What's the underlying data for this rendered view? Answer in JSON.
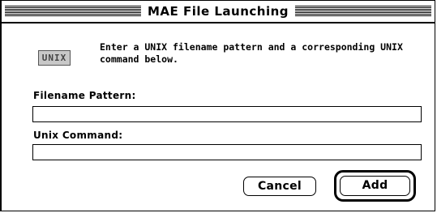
{
  "dialog": {
    "title": "MAE File Launching",
    "icon": {
      "name": "unix-icon",
      "label": "UNIX"
    },
    "message": "Enter a UNIX filename pattern and a corresponding UNIX command below."
  },
  "form": {
    "filename_pattern": {
      "label": "Filename Pattern:",
      "value": ""
    },
    "unix_command": {
      "label": "Unix Command:",
      "value": ""
    }
  },
  "buttons": {
    "cancel_label": "Cancel",
    "add_label": "Add"
  }
}
